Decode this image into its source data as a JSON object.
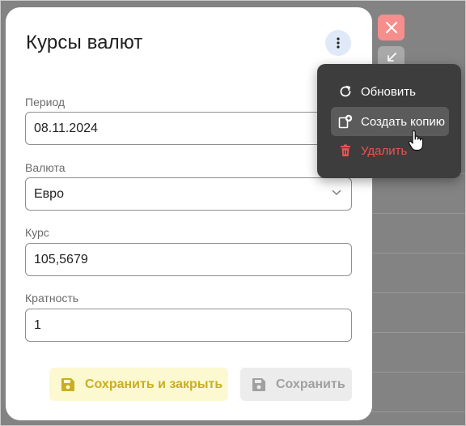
{
  "dialog": {
    "title": "Курсы валют",
    "fields": [
      {
        "label": "Период",
        "value": "08.11.2024"
      },
      {
        "label": "Валюта",
        "value": "Евро"
      },
      {
        "label": "Курс",
        "value": "105,5679"
      },
      {
        "label": "Кратность",
        "value": "1"
      }
    ],
    "buttons": {
      "save_and_close": "Сохранить и закрыть",
      "save": "Сохранить"
    }
  },
  "menu": {
    "items": [
      {
        "label": "Обновить",
        "icon": "refresh-icon"
      },
      {
        "label": "Создать копию",
        "icon": "copy-add-icon",
        "state": "hover"
      },
      {
        "label": "Удалить",
        "icon": "trash-icon",
        "color": "#f05252"
      }
    ]
  },
  "colors": {
    "backdrop": "#838383",
    "close_button": "#f58e8c",
    "kebab_bg": "#dfe9f7",
    "menu_bg": "#3d3d3d",
    "save_close_bg": "#fcf8d0",
    "save_close_text": "#c9ae22",
    "danger": "#f05252"
  }
}
